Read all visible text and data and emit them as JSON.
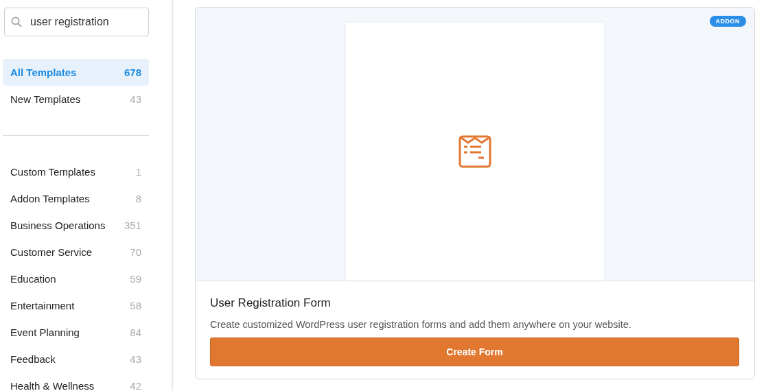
{
  "search": {
    "value": "user registration"
  },
  "categories": [
    {
      "label": "All Templates",
      "count": "678",
      "selected": true
    },
    {
      "label": "New Templates",
      "count": "43",
      "selected": false
    }
  ],
  "groups": [
    {
      "label": "Custom Templates",
      "count": "1",
      "selected": false
    },
    {
      "label": "Addon Templates",
      "count": "8",
      "selected": false
    },
    {
      "label": "Business Operations",
      "count": "351",
      "selected": false
    },
    {
      "label": "Customer Service",
      "count": "70",
      "selected": false
    },
    {
      "label": "Education",
      "count": "59",
      "selected": false
    },
    {
      "label": "Entertainment",
      "count": "58",
      "selected": false
    },
    {
      "label": "Event Planning",
      "count": "84",
      "selected": false
    },
    {
      "label": "Feedback",
      "count": "43",
      "selected": false
    },
    {
      "label": "Health & Wellness",
      "count": "42",
      "selected": false
    }
  ],
  "template": {
    "badge": "ADDON",
    "title": "User Registration Form",
    "description": "Create customized WordPress user registration forms and add them anywhere on your website.",
    "button": "Create Form"
  }
}
